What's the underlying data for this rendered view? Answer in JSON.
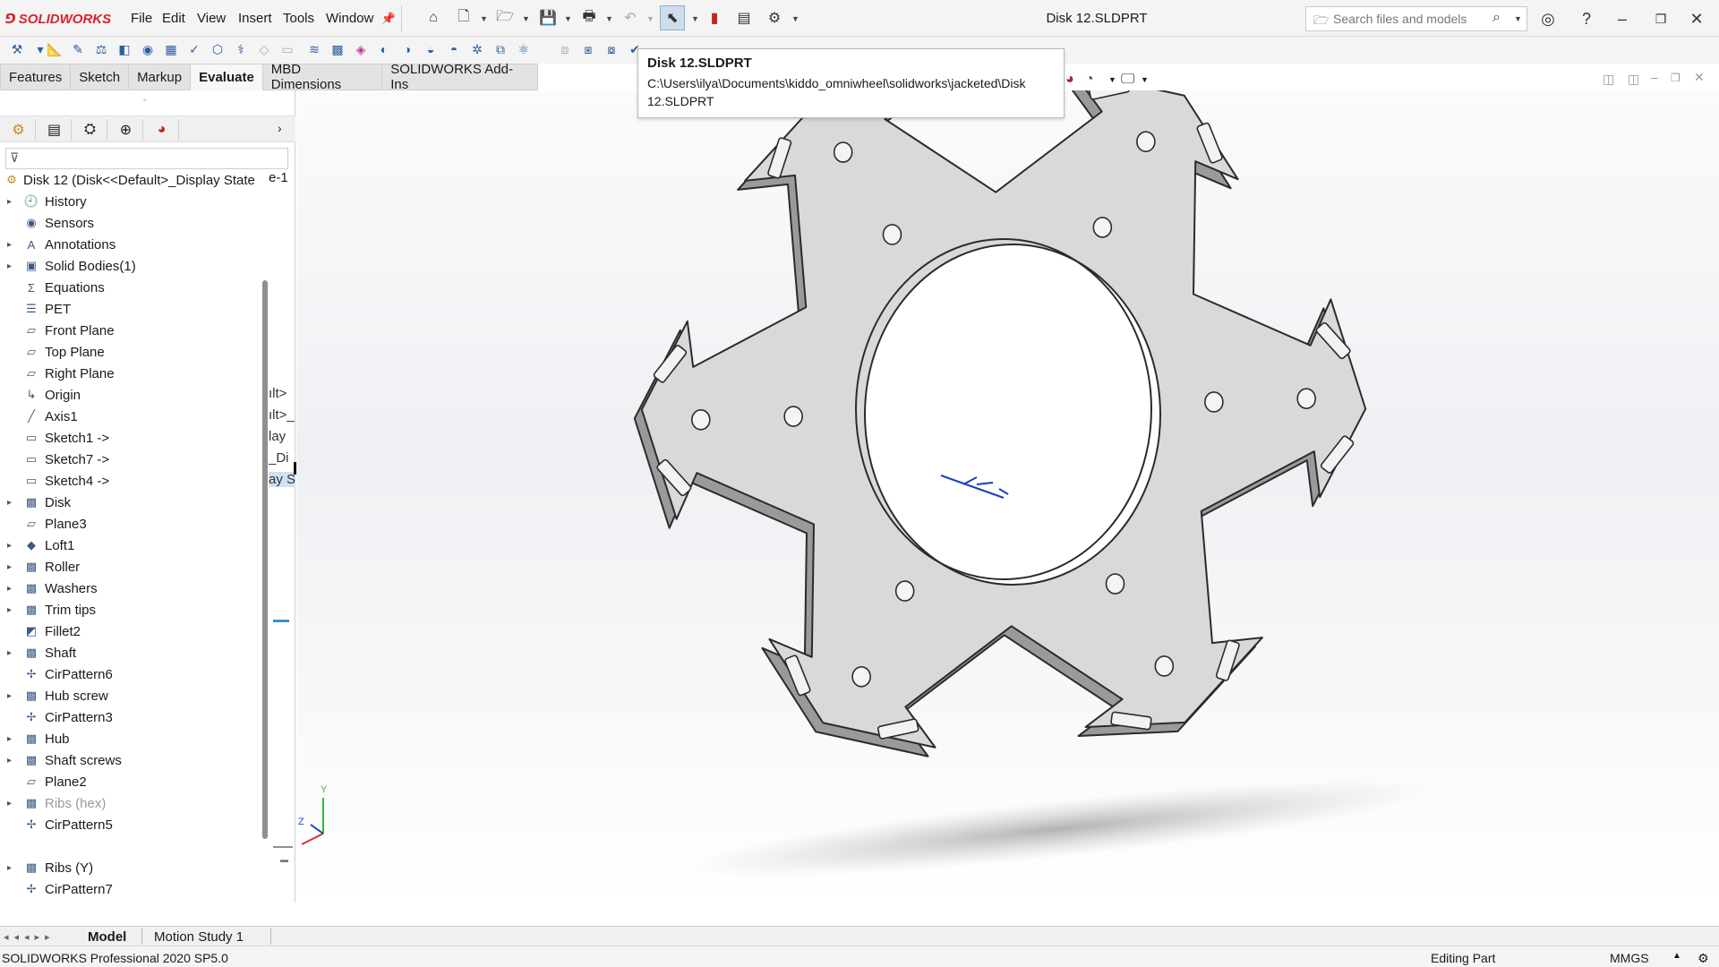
{
  "app": {
    "brand": "SOLIDWORKS",
    "document_title": "Disk 12.SLDPRT",
    "search_placeholder": "Search files and models"
  },
  "menu": [
    "File",
    "Edit",
    "View",
    "Insert",
    "Tools",
    "Window"
  ],
  "command_tabs": [
    {
      "label": "Features",
      "active": false
    },
    {
      "label": "Sketch",
      "active": false
    },
    {
      "label": "Markup",
      "active": false
    },
    {
      "label": "Evaluate",
      "active": true
    },
    {
      "label": "MBD Dimensions",
      "active": false
    },
    {
      "label": "SOLIDWORKS Add-Ins",
      "active": false
    }
  ],
  "tooltip": {
    "title": "Disk 12.SLDPRT",
    "path": "C:\\Users\\ilya\\Documents\\kiddo_omniwheel\\solidworks\\jacketed\\Disk 12.SLDPRT"
  },
  "feature_tree": {
    "root": "Disk 12  (Disk<<Default>_Display State",
    "root_overflow": "e-1",
    "items": [
      {
        "label": "History",
        "icon": "history-icon",
        "expandable": true,
        "dim": false
      },
      {
        "label": "Sensors",
        "icon": "sensors-icon",
        "expandable": false,
        "dim": false
      },
      {
        "label": "Annotations",
        "icon": "annotations-icon",
        "expandable": true,
        "dim": false
      },
      {
        "label": "Solid Bodies(1)",
        "icon": "solid-bodies-icon",
        "expandable": true,
        "dim": false
      },
      {
        "label": "Equations",
        "icon": "equations-icon",
        "expandable": false,
        "dim": false
      },
      {
        "label": "PET",
        "icon": "material-icon",
        "expandable": false,
        "dim": false
      },
      {
        "label": "Front Plane",
        "icon": "plane-icon",
        "expandable": false,
        "dim": false
      },
      {
        "label": "Top Plane",
        "icon": "plane-icon",
        "expandable": false,
        "dim": false
      },
      {
        "label": "Right Plane",
        "icon": "plane-icon",
        "expandable": false,
        "dim": false
      },
      {
        "label": "Origin",
        "icon": "origin-icon",
        "expandable": false,
        "dim": false
      },
      {
        "label": "Axis1",
        "icon": "axis-icon",
        "expandable": false,
        "dim": false
      },
      {
        "label": "Sketch1 ->",
        "icon": "sketch-icon",
        "expandable": false,
        "dim": false
      },
      {
        "label": "Sketch7 ->",
        "icon": "sketch-icon",
        "expandable": false,
        "dim": false
      },
      {
        "label": "Sketch4 ->",
        "icon": "sketch-icon",
        "expandable": false,
        "dim": false
      },
      {
        "label": "Disk",
        "icon": "part-icon",
        "expandable": true,
        "dim": false
      },
      {
        "label": "Plane3",
        "icon": "plane-icon",
        "expandable": false,
        "dim": false
      },
      {
        "label": "Loft1",
        "icon": "loft-icon",
        "expandable": true,
        "dim": false
      },
      {
        "label": "Roller",
        "icon": "part-icon",
        "expandable": true,
        "dim": false
      },
      {
        "label": "Washers",
        "icon": "part-icon",
        "expandable": true,
        "dim": false
      },
      {
        "label": "Trim tips",
        "icon": "part-icon",
        "expandable": true,
        "dim": false
      },
      {
        "label": "Fillet2",
        "icon": "fillet-icon",
        "expandable": false,
        "dim": false
      },
      {
        "label": "Shaft",
        "icon": "part-icon",
        "expandable": true,
        "dim": false
      },
      {
        "label": "CirPattern6",
        "icon": "circular-pattern-icon",
        "expandable": false,
        "dim": false
      },
      {
        "label": "Hub screw",
        "icon": "part-icon",
        "expandable": true,
        "dim": false
      },
      {
        "label": "CirPattern3",
        "icon": "circular-pattern-icon",
        "expandable": false,
        "dim": false
      },
      {
        "label": "Hub",
        "icon": "part-icon",
        "expandable": true,
        "dim": false
      },
      {
        "label": "Shaft screws",
        "icon": "part-icon",
        "expandable": true,
        "dim": false
      },
      {
        "label": "Plane2",
        "icon": "plane-icon",
        "expandable": false,
        "dim": false
      },
      {
        "label": "Ribs (hex)",
        "icon": "part-icon",
        "expandable": true,
        "dim": true
      },
      {
        "label": "CirPattern5",
        "icon": "circular-pattern-icon",
        "expandable": false,
        "dim": false
      }
    ],
    "lower_items": [
      {
        "label": "Ribs (Y)",
        "icon": "part-icon",
        "expandable": true,
        "dim": false
      },
      {
        "label": "CirPattern7",
        "icon": "circular-pattern-icon",
        "expandable": false,
        "dim": false
      }
    ]
  },
  "bottom_tabs": [
    {
      "label": "Model",
      "active": true
    },
    {
      "label": "Motion Study 1",
      "active": false
    }
  ],
  "status": {
    "version": "SOLIDWORKS Professional 2020 SP5.0",
    "mode": "Editing Part",
    "units": "MMGS"
  },
  "colors": {
    "brand_red": "#d9232e",
    "part_fill": "#d9d9d9",
    "edge": "#2b2b2b"
  }
}
